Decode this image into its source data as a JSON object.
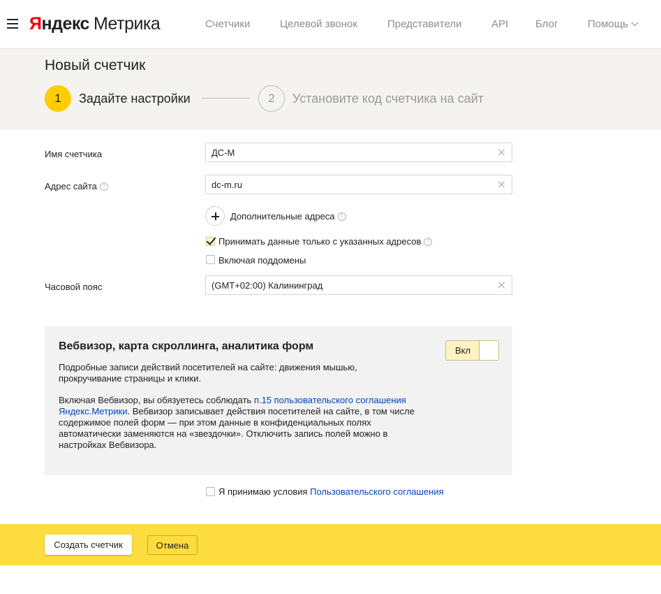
{
  "header": {
    "logo_ya": "Я",
    "logo_ndex": "ндекс",
    "logo_product": "Метрика",
    "nav": [
      {
        "label": "Счетчики"
      },
      {
        "label": "Целевой звонок"
      },
      {
        "label": "Представители"
      },
      {
        "label": "API"
      },
      {
        "label": "Блог"
      },
      {
        "label": "Помощь"
      }
    ]
  },
  "page": {
    "title": "Новый счетчик",
    "steps": [
      {
        "number": "1",
        "label": "Задайте настройки"
      },
      {
        "number": "2",
        "label": "Установите код счетчика на сайт"
      }
    ]
  },
  "form": {
    "name_label": "Имя счетчика",
    "name_value": "ДС-М",
    "site_label": "Адрес сайта",
    "site_value": "dc-m.ru",
    "add_addresses_label": "Дополнительные адреса",
    "accept_only_label": "Принимать данные только с указанных адресов",
    "accept_only_checked": true,
    "subdomains_label": "Включая поддомены",
    "subdomains_checked": false,
    "timezone_label": "Часовой пояс",
    "timezone_value": "(GMT+02:00) Калининград",
    "help_glyph": "?"
  },
  "webvisor": {
    "title": "Вебвизор, карта скроллинга, аналитика форм",
    "toggle_label": "Вкл",
    "desc": "Подробные записи действий посетителей на сайте: движения мышью, прокручивание страницы и клики.",
    "desc2_prefix": "Включая Вебвизор, вы обязуетесь соблюдать ",
    "desc2_link": "п.15 пользовательского соглашения Яндекс.Метрики",
    "desc2_suffix": ". Вебвизор записывает действия посетителей на сайте, в том числе содержимое полей форм — при этом данные в конфиденциальных полях автоматически заменяются на «звездочки». Отключить запись полей можно в настройках Вебвизора."
  },
  "agreement": {
    "prefix": "Я принимаю условия ",
    "link": "Пользовательского соглашения",
    "checked": false
  },
  "footer": {
    "create_label": "Создать счетчик",
    "cancel_label": "Отмена"
  },
  "colors": {
    "accent_yellow": "#ffcc00",
    "footer_yellow": "#fddc3f",
    "logo_red": "#f00000",
    "link_blue": "#0044bb"
  }
}
